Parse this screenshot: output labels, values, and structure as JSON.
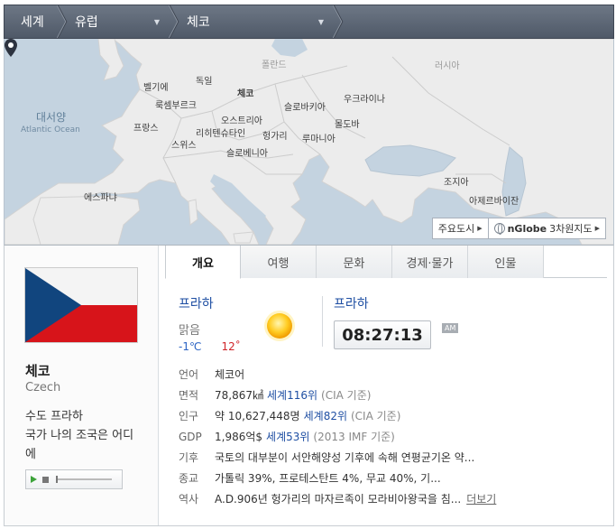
{
  "breadcrumb": {
    "world": "세계",
    "continent": "유럽",
    "country": "체코"
  },
  "map": {
    "labels": {
      "poland": "폴란드",
      "russia": "러시아",
      "belgium": "벨기에",
      "germany": "독일",
      "czech": "체코",
      "luxembourg": "룩셈부르크",
      "ukraine": "우크라이나",
      "slovakia": "슬로바키아",
      "atlantic_ko": "대서양",
      "atlantic_en": "Atlantic Ocean",
      "france": "프랑스",
      "austria": "오스트리아",
      "moldova": "몰도바",
      "liechtenstein": "리히텐슈타인",
      "hungary": "헝가리",
      "romania": "루마니아",
      "switzerland": "스위스",
      "slovenia": "슬로베니아",
      "georgia": "조지아",
      "spain": "에스파냐",
      "azerbaijan": "아제르바이잔"
    },
    "buttons": {
      "major_cities": "주요도시",
      "nglobe_brand": "nGlobe",
      "nglobe_label": "3차원지도"
    }
  },
  "country": {
    "name_ko": "체코",
    "name_en": "Czech",
    "capital_label": "수도",
    "capital": "프라하",
    "anthem_label": "국가",
    "anthem": "나의 조국은 어디에"
  },
  "tabs": [
    "개요",
    "여행",
    "문화",
    "경제·물가",
    "인물"
  ],
  "weather": {
    "city": "프라하",
    "condition": "맑음",
    "low": "-1℃",
    "high": "12˚",
    "icon": "sun-icon"
  },
  "clock": {
    "city": "프라하",
    "time": "08:27:13",
    "ampm": "AM"
  },
  "info": {
    "language": {
      "label": "언어",
      "value": "체코어"
    },
    "area": {
      "label": "면적",
      "value": "78,867㎢",
      "rank": "세계116위",
      "source": "(CIA 기준)"
    },
    "population": {
      "label": "인구",
      "value": "약 10,627,448명",
      "rank": "세계82위",
      "source": "(CIA 기준)"
    },
    "gdp": {
      "label": "GDP",
      "value": "1,986억$",
      "rank": "세계53위",
      "source": "(2013 IMF 기준)"
    },
    "climate": {
      "label": "기후",
      "value": "국토의 대부분이 서안해양성 기후에 속해 연평균기온 약..."
    },
    "religion": {
      "label": "종교",
      "value": "가톨릭 39%, 프로테스탄트 4%, 무교 40%, 기..."
    },
    "history": {
      "label": "역사",
      "value": "A.D.906년 헝가리의 마자르족이 모라비아왕국을 침...",
      "more": "더보기"
    }
  },
  "colors": {
    "link": "#1f4fa3",
    "low_temp": "#2c64c4",
    "high_temp": "#d0252a",
    "flag_blue": "#11457e",
    "flag_red": "#d7141a"
  }
}
